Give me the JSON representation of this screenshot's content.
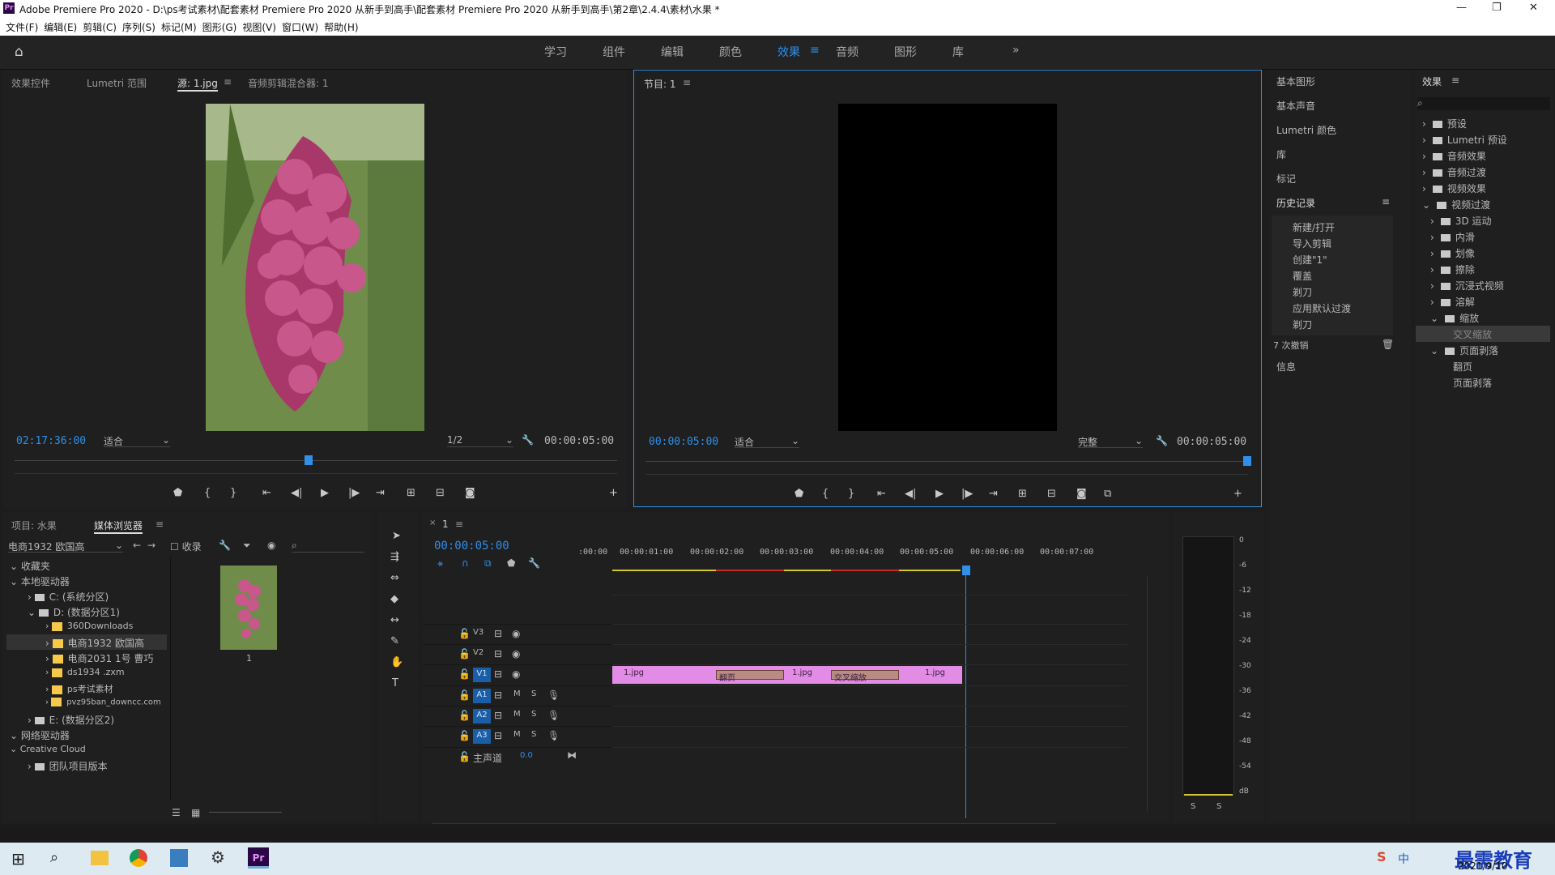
{
  "title": "Adobe Premiere Pro 2020 - D:\\ps考试素材\\配套素材 Premiere Pro 2020 从新手到高手\\配套素材 Premiere Pro 2020 从新手到高手\\第2章\\2.4.4\\素材\\水果 *",
  "menu": [
    "文件(F)",
    "编辑(E)",
    "剪辑(C)",
    "序列(S)",
    "标记(M)",
    "图形(G)",
    "视图(V)",
    "窗口(W)",
    "帮助(H)"
  ],
  "workspaces": [
    "学习",
    "组件",
    "编辑",
    "颜色",
    "效果",
    "音频",
    "图形",
    "库"
  ],
  "source_tabs": [
    "效果控件",
    "Lumetri 范围",
    "源: 1.jpg",
    "音频剪辑混合器: 1"
  ],
  "source": {
    "tc": "02:17:36:00",
    "fit": "适合",
    "res": "1/2",
    "dur": "00:00:05:00"
  },
  "program": {
    "tab": "节目: 1",
    "tc": "00:00:05:00",
    "fit": "适合",
    "quality": "完整",
    "dur": "00:00:05:00"
  },
  "right_panels": [
    "基本图形",
    "基本声音",
    "Lumetri 颜色",
    "库",
    "标记",
    "历史记录",
    "信息"
  ],
  "history": {
    "items": [
      "新建/打开",
      "导入剪辑",
      "创建\"1\"",
      "覆盖",
      "剃刀",
      "应用默认过渡",
      "剃刀"
    ],
    "undo": "7 次撤销"
  },
  "effects": {
    "title": "效果",
    "items": [
      "预设",
      "Lumetri 预设",
      "音频效果",
      "音频过渡",
      "视频效果",
      "视频过渡",
      "3D 运动",
      "内滑",
      "划像",
      "擦除",
      "沉浸式视频",
      "溶解",
      "缩放",
      "交叉缩放",
      "页面剥落",
      "翻页",
      "页面剥落"
    ]
  },
  "project": {
    "tabs": [
      "项目: 水果",
      "媒体浏览器"
    ],
    "location": "电商1932 欧国高",
    "ingest": "收录",
    "tree": [
      "收藏夹",
      "本地驱动器",
      "C: (系统分区)",
      "D: (数据分区1)",
      "360Downloads",
      "电商1932 欧国高",
      "电商2031 1号 曹巧",
      "ds1934 .zxm",
      "ps考试素材",
      "pvz95ban_downcc.com",
      "E: (数据分区2)",
      "网络驱动器",
      "Creative Cloud",
      "团队项目版本"
    ],
    "thumb_label": "1"
  },
  "timeline": {
    "tab": "1",
    "tc": "00:00:05:00",
    "ruler": [
      ":00:00",
      "00:00:01:00",
      "00:00:02:00",
      "00:00:03:00",
      "00:00:04:00",
      "00:00:05:00",
      "00:00:06:00",
      "00:00:07:00"
    ],
    "tracks": [
      "V3",
      "V2",
      "V1",
      "A1",
      "A2",
      "A3"
    ],
    "master": "主声道",
    "master_val": "0.0",
    "clips": [
      "1.jpg",
      "翻页",
      "1.jpg",
      "交叉缩放",
      "1.jpg"
    ]
  },
  "meter": {
    "scale": [
      "0",
      "-6",
      "-12",
      "-18",
      "-24",
      "-30",
      "-36",
      "-42",
      "-48",
      "-54",
      "dB"
    ],
    "solo": [
      "S",
      "S"
    ]
  },
  "taskbar": {
    "date": "2021/9/10",
    "watermark": "最需教育",
    "ime": "中"
  }
}
